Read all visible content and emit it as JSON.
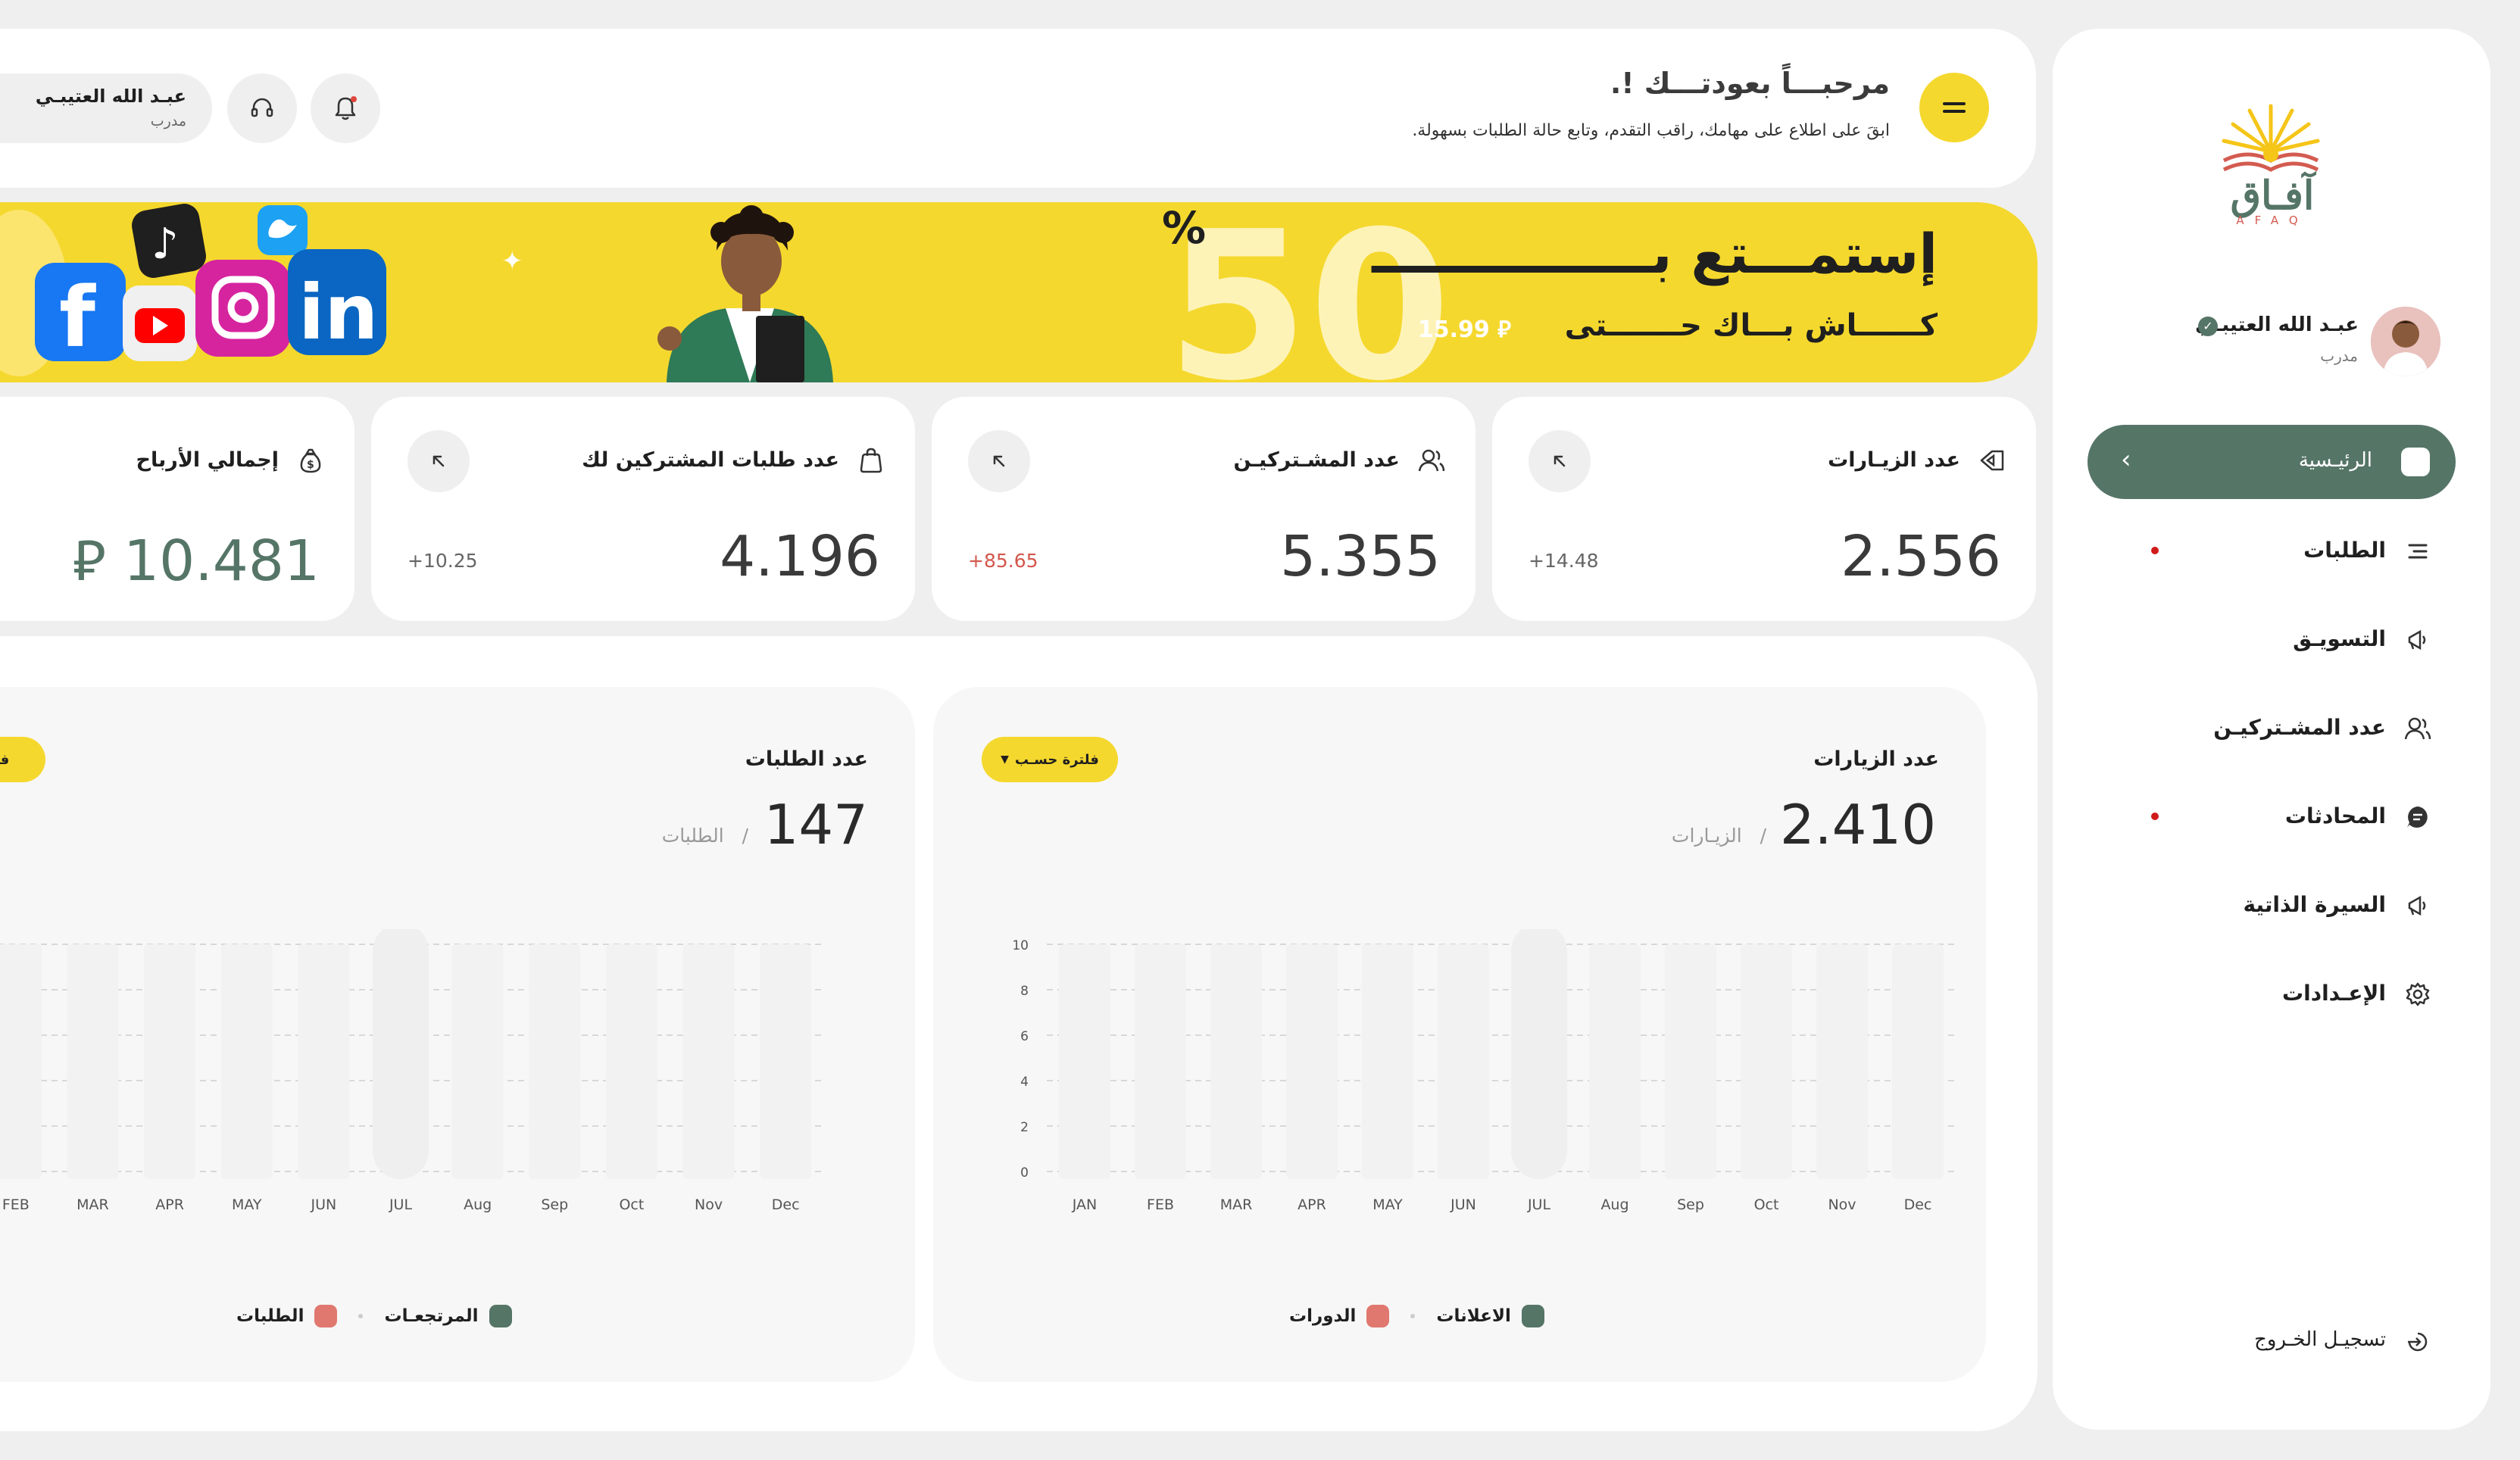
{
  "app": {
    "logo_text": "آفـاق",
    "logo_sub": "AFAQ"
  },
  "sidebar": {
    "user_name": "عبـد الله العتيبـي",
    "user_role": "مدرب",
    "items": [
      {
        "label": "الرئيـسية",
        "icon": "home-icon",
        "active": true
      },
      {
        "label": "الطلبات",
        "icon": "list-icon",
        "dot": true
      },
      {
        "label": "التسويـق",
        "icon": "megaphone-icon"
      },
      {
        "label": "عدد المشـتركيـن",
        "icon": "users-icon"
      },
      {
        "label": "المحادثات",
        "icon": "chat-icon",
        "dot": true
      },
      {
        "label": "السيرة الذاتية",
        "icon": "megaphone-icon"
      },
      {
        "label": "الإعـدادات",
        "icon": "gear-icon"
      }
    ],
    "logout_label": "تسجيـل الخـروج"
  },
  "header": {
    "welcome": "مرحبـــاً بعودتـــك !.",
    "subtitle": "ابقَ على اطلاع على مهامك، راقب التقدم، وتابع حالة الطلبات بسهولة.",
    "user_name": "عبـد الله العتيبـي",
    "user_role": "مدرب"
  },
  "banner": {
    "title": "إستمـــتع بـــــــــــــــ",
    "subtitle": "كــــــاش بـــاك حـــــــتى",
    "price": "15.99 ⃁",
    "big_number": "50",
    "percent": "%"
  },
  "stats": [
    {
      "title": "عدد الزيـارات",
      "value": "2.556",
      "change": "+14.48",
      "change_color": "#666666",
      "icon": "chart-icon"
    },
    {
      "title": "عدد المشـتركيـن",
      "value": "5.355",
      "change": "+85.65",
      "change_color": "#d3574c",
      "icon": "users-icon"
    },
    {
      "title": "عدد طلبات المشتركين لك",
      "value": "4.196",
      "change": "+10.25",
      "change_color": "#666666",
      "icon": "bag-icon"
    },
    {
      "title": "إجمالي الأرباح",
      "value": "10.481",
      "currency": "⃁",
      "icon": "money-bag-icon"
    }
  ],
  "charts": {
    "visits": {
      "title": "عدد الزيارات",
      "big_value": "2.410",
      "unit": "الزيـارات",
      "filter_label": "فلترة حسـب",
      "legend": [
        {
          "label": "الاعلانات",
          "color": "#557567"
        },
        {
          "label": "الدورات",
          "color": "#e07870"
        }
      ]
    },
    "orders": {
      "title": "عدد الطلبات",
      "big_value": "147",
      "unit": "الطلبات",
      "filter_label": "فلترة",
      "legend": [
        {
          "label": "المرتجعـات",
          "color": "#557567"
        },
        {
          "label": "الطلبات",
          "color": "#e07870"
        }
      ]
    }
  },
  "chart_data": [
    {
      "type": "bar",
      "title": "عدد الزيارات",
      "categories": [
        "JAN",
        "FEB",
        "MAR",
        "APR",
        "MAY",
        "JUN",
        "JUL",
        "Aug",
        "Sep",
        "Oct",
        "Nov",
        "Dec"
      ],
      "ylim": [
        0,
        10
      ],
      "yticks": [
        0,
        2,
        4,
        6,
        8,
        10
      ],
      "grid": true,
      "highlight_index": 6,
      "series": [
        {
          "name": "الاعلانات",
          "values": [
            0,
            0,
            0,
            0,
            0,
            0,
            0,
            0,
            0,
            0,
            0,
            0
          ]
        },
        {
          "name": "الدورات",
          "values": [
            0,
            0,
            0,
            0,
            0,
            0,
            0,
            0,
            0,
            0,
            0,
            0
          ]
        }
      ]
    },
    {
      "type": "bar",
      "title": "عدد الطلبات",
      "categories": [
        "FEB",
        "MAR",
        "APR",
        "MAY",
        "JUN",
        "JUL",
        "Aug",
        "Sep",
        "Oct",
        "Nov",
        "Dec"
      ],
      "ylim": [
        0,
        10
      ],
      "grid": true,
      "highlight_index": 5,
      "series": [
        {
          "name": "المرتجعـات",
          "values": [
            0,
            0,
            0,
            0,
            0,
            0,
            0,
            0,
            0,
            0,
            0
          ]
        },
        {
          "name": "الطلبات",
          "values": [
            0,
            0,
            0,
            0,
            0,
            0,
            0,
            0,
            0,
            0,
            0
          ]
        }
      ]
    }
  ]
}
